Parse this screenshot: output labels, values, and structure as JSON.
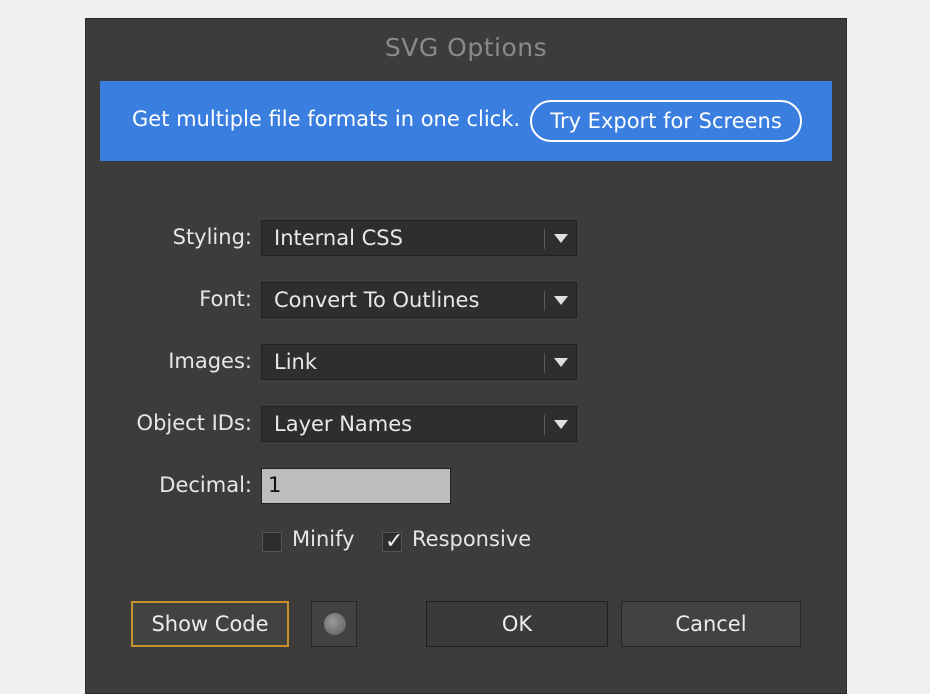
{
  "dialog": {
    "title": "SVG Options"
  },
  "banner": {
    "text": "Get multiple file formats in one click.",
    "button_label": "Try Export for Screens"
  },
  "fields": {
    "styling": {
      "label": "Styling:",
      "value": "Internal CSS"
    },
    "font": {
      "label": "Font:",
      "value": "Convert To Outlines"
    },
    "images": {
      "label": "Images:",
      "value": "Link"
    },
    "object_ids": {
      "label": "Object IDs:",
      "value": "Layer Names"
    },
    "decimal": {
      "label": "Decimal:",
      "value": "1"
    }
  },
  "checkboxes": {
    "minify": {
      "label": "Minify",
      "checked": false
    },
    "responsive": {
      "label": "Responsive",
      "checked": true
    }
  },
  "buttons": {
    "show_code": "Show Code",
    "web_icon": "globe-icon",
    "ok": "OK",
    "cancel": "Cancel"
  },
  "colors": {
    "banner": "#3a7ee0",
    "dialog_bg": "#3c3c3c",
    "focus_border": "#c8902a"
  }
}
